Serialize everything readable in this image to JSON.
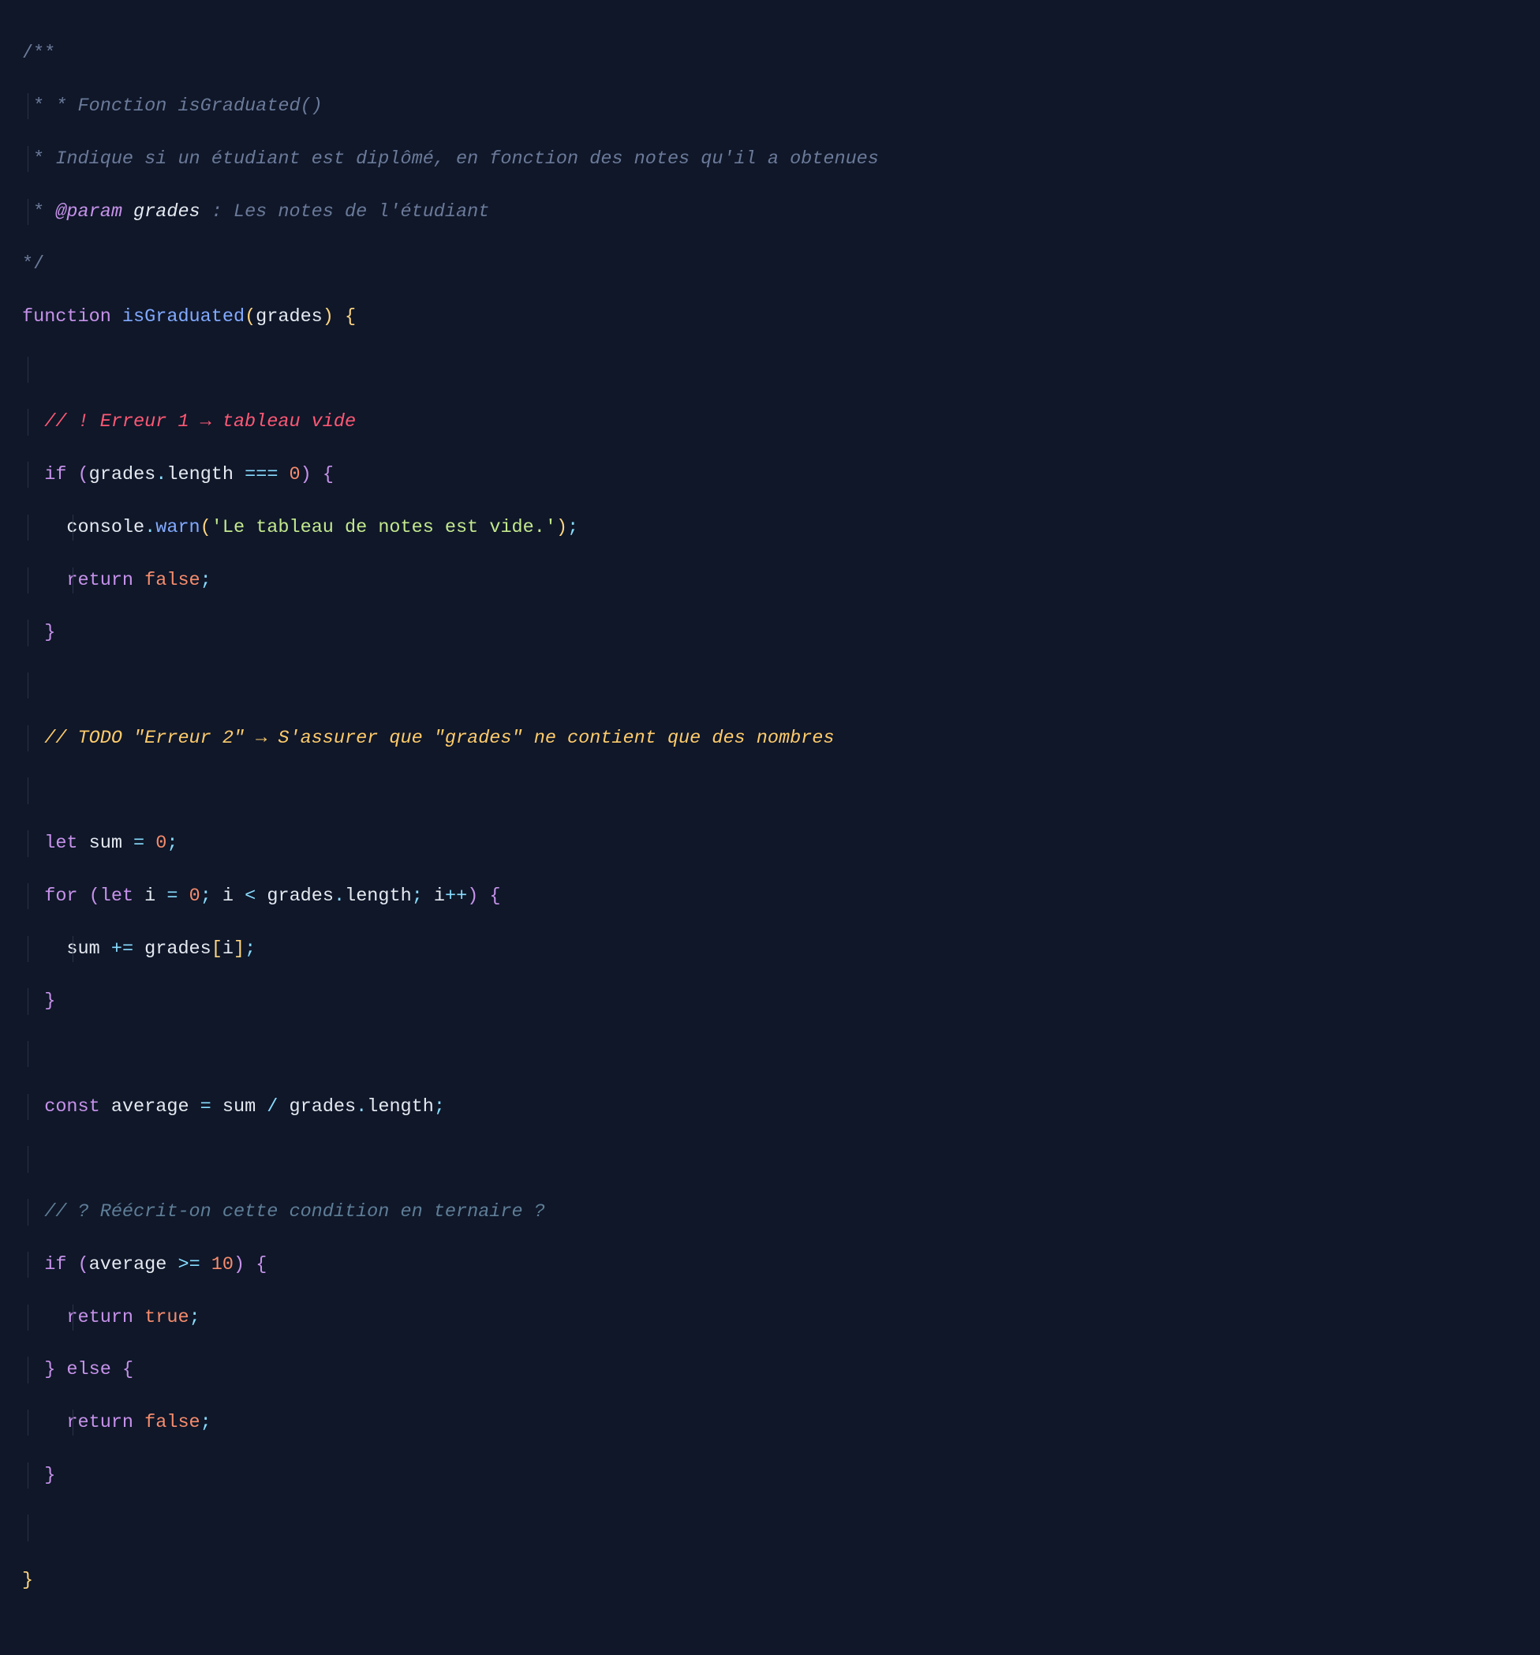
{
  "code": {
    "l1": "/**",
    "l2_star": " * ",
    "l2_text": "* Fonction isGraduated()",
    "l3_star": " * ",
    "l3_text": "Indique si un étudiant est diplômé, en fonction des notes qu'il a obtenues",
    "l4_star": " * ",
    "l4_at": "@param",
    "l4_name": " grades",
    "l4_rest": " : Les notes de l'étudiant",
    "l5": "*/",
    "l6_function": "function",
    "l6_name": " isGraduated",
    "l6_p_open": "(",
    "l6_param": "grades",
    "l6_p_close": ")",
    "l6_brace": " {",
    "l8_comment": "// ! Erreur 1 → tableau vide",
    "l9_if": "if",
    "l9_po": " (",
    "l9_grades": "grades",
    "l9_dot": ".",
    "l9_length": "length",
    "l9_eq": " ===",
    "l9_zero": " 0",
    "l9_pc": ")",
    "l9_bo": " {",
    "l10_console": "console",
    "l10_dot": ".",
    "l10_warn": "warn",
    "l10_po": "(",
    "l10_str": "'Le tableau de notes est vide.'",
    "l10_pc": ")",
    "l10_semi": ";",
    "l11_return": "return",
    "l11_false": " false",
    "l11_semi": ";",
    "l12_bc": "}",
    "l14_comment": "// TODO \"Erreur 2\" → S'assurer que \"grades\" ne contient que des nombres",
    "l16_let": "let",
    "l16_sum": " sum",
    "l16_eq": " =",
    "l16_zero": " 0",
    "l16_semi": ";",
    "l17_for": "for",
    "l17_po": " (",
    "l17_let": "let",
    "l17_i": " i",
    "l17_eq": " =",
    "l17_zero": " 0",
    "l17_semi1": ";",
    "l17_i2": " i",
    "l17_lt": " <",
    "l17_grades": " grades",
    "l17_dot": ".",
    "l17_length": "length",
    "l17_semi2": ";",
    "l17_i3": " i",
    "l17_pp": "++",
    "l17_pc": ")",
    "l17_bo": " {",
    "l18_sum": "sum",
    "l18_pe": " +=",
    "l18_grades": " grades",
    "l18_bo": "[",
    "l18_i": "i",
    "l18_bc": "]",
    "l18_semi": ";",
    "l19_bc": "}",
    "l21_const": "const",
    "l21_avg": " average",
    "l21_eq": " =",
    "l21_sum": " sum",
    "l21_div": " /",
    "l21_grades": " grades",
    "l21_dot": ".",
    "l21_length": "length",
    "l21_semi": ";",
    "l23_comment": "// ? Réécrit-on cette condition en ternaire ?",
    "l24_if": "if",
    "l24_po": " (",
    "l24_avg": "average",
    "l24_ge": " >=",
    "l24_ten": " 10",
    "l24_pc": ")",
    "l24_bo": " {",
    "l25_return": "return",
    "l25_true": " true",
    "l25_semi": ";",
    "l26_bc": "}",
    "l26_else": " else",
    "l26_bo": " {",
    "l27_return": "return",
    "l27_false": " false",
    "l27_semi": ";",
    "l28_bc": "}",
    "l30_bc": "}"
  }
}
